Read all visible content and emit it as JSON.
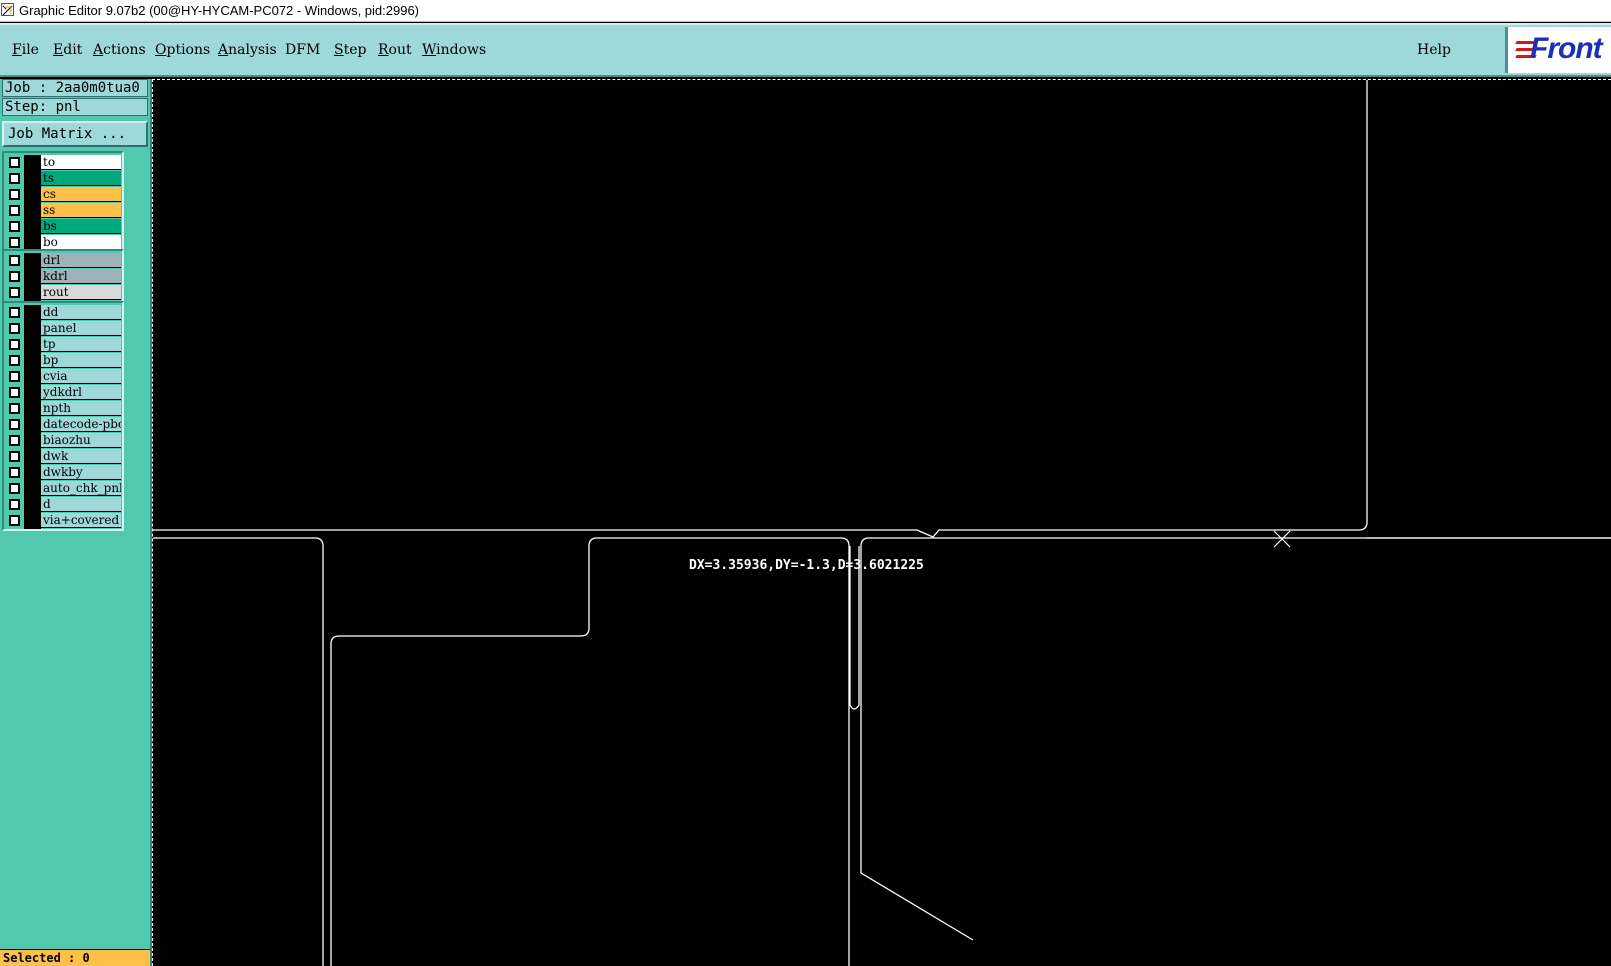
{
  "window": {
    "title": "Graphic Editor 9.07b2 (00@HY-HYCAM-PC072 - Windows, pid:2996)"
  },
  "menu": {
    "items": [
      {
        "label": "File",
        "accel": "F",
        "rest": "ile"
      },
      {
        "label": "Edit",
        "accel": "E",
        "rest": "dit"
      },
      {
        "label": "Actions",
        "accel": "A",
        "rest": "ctions"
      },
      {
        "label": "Options",
        "accel": "O",
        "rest": "ptions"
      },
      {
        "label": "Analysis",
        "accel": "A",
        "rest": "nalysis"
      },
      {
        "label": "DFM",
        "accel": "",
        "rest": "DFM"
      },
      {
        "label": "Step",
        "accel": "S",
        "rest": "tep"
      },
      {
        "label": "Rout",
        "accel": "R",
        "rest": "out"
      },
      {
        "label": "Windows",
        "accel": "W",
        "rest": "indows"
      }
    ],
    "help": "Help",
    "logo": "Front"
  },
  "panel": {
    "job": "Job : 2aa0m0tua0",
    "step": "Step: pnl",
    "job_matrix": "Job Matrix ...",
    "groups": [
      {
        "layers": [
          {
            "name": "to",
            "color": "#ffffff"
          },
          {
            "name": "ts",
            "color": "#00a87e"
          },
          {
            "name": "cs",
            "color": "#ffc04a"
          },
          {
            "name": "ss",
            "color": "#ffc04a"
          },
          {
            "name": "bs",
            "color": "#00a87e"
          },
          {
            "name": "bo",
            "color": "#ffffff"
          }
        ]
      },
      {
        "layers": [
          {
            "name": "drl",
            "color": "#9fb2ba"
          },
          {
            "name": "kdrl",
            "color": "#9fb2ba"
          },
          {
            "name": "rout",
            "color": "#d8d8d8"
          }
        ]
      },
      {
        "layers": [
          {
            "name": "dd",
            "color": "#9fd8d8"
          },
          {
            "name": "panel",
            "color": "#9fd8d8"
          },
          {
            "name": "tp",
            "color": "#9fd8d8"
          },
          {
            "name": "bp",
            "color": "#9fd8d8"
          },
          {
            "name": "cvia",
            "color": "#9fd8d8"
          },
          {
            "name": "ydkdrl",
            "color": "#9fd8d8"
          },
          {
            "name": "npth",
            "color": "#9fd8d8"
          },
          {
            "name": "datecode-pbc",
            "color": "#9fd8d8"
          },
          {
            "name": "biaozhu",
            "color": "#9fd8d8"
          },
          {
            "name": "dwk",
            "color": "#9fd8d8"
          },
          {
            "name": "dwkby",
            "color": "#9fd8d8"
          },
          {
            "name": "auto_chk_pnl",
            "color": "#9fd8d8"
          },
          {
            "name": "d",
            "color": "#9fd8d8"
          },
          {
            "name": "via+covered",
            "color": "#9fd8d8"
          }
        ]
      }
    ],
    "selected": "Selected : 0"
  },
  "canvas": {
    "measure": "DX=3.35936,DY=-1.3,D=3.6021225"
  }
}
